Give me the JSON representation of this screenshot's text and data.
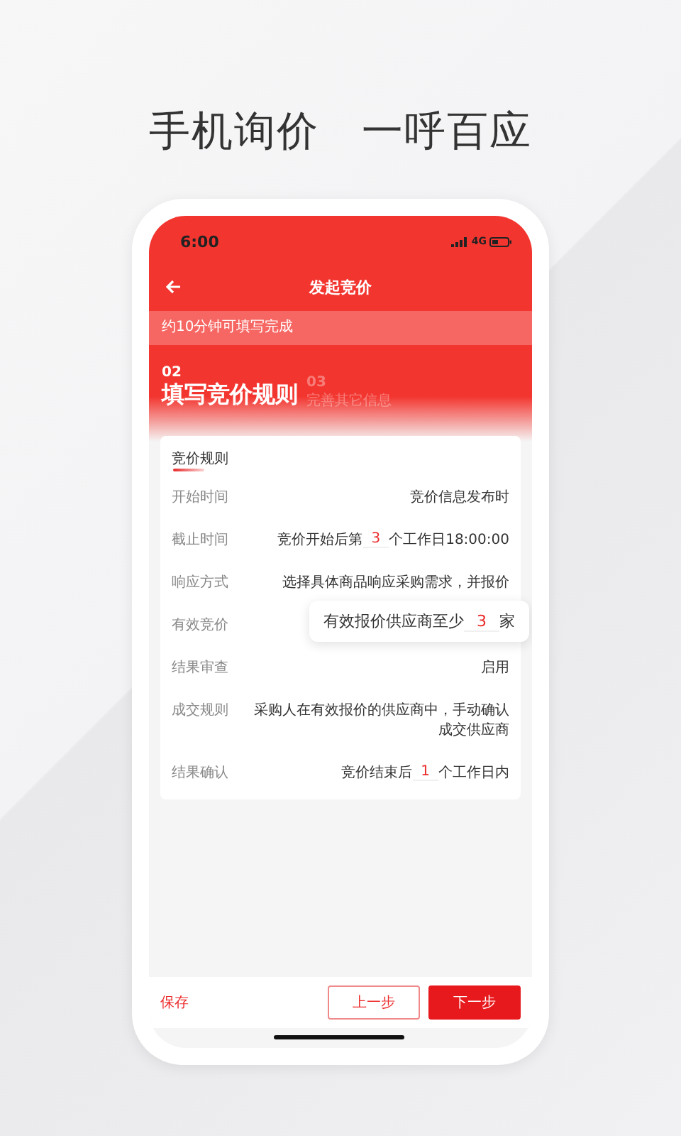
{
  "headline": [
    "手机询价",
    "一呼百应"
  ],
  "status_bar": {
    "time": "6:00",
    "network": "4G"
  },
  "nav": {
    "title": "发起竞价"
  },
  "notice": "约10分钟可填写完成",
  "steps": [
    {
      "number": "02",
      "label": "填写竞价规则",
      "selected": true
    },
    {
      "number": "03",
      "label": "完善其它信息",
      "selected": false
    }
  ],
  "card": {
    "title": "竞价规则",
    "rows": [
      {
        "label": "开始时间",
        "before": "竞价信息发布时"
      },
      {
        "label": "截止时间",
        "before": "竞价开始后第",
        "number": "3",
        "after": "个工作日18:00:00"
      },
      {
        "label": "响应方式",
        "before": "选择具体商品响应采购需求，并报价"
      },
      {
        "label": "有效竞价",
        "callout": {
          "before": "有效报价供应商至少",
          "number": "3",
          "after": "家"
        }
      },
      {
        "label": "结果审查",
        "before": "启用"
      },
      {
        "label": "成交规则",
        "before": "采购人在有效报价的供应商中，手动确认成交供应商"
      },
      {
        "label": "结果确认",
        "before": "竞价结束后",
        "number": "1",
        "after": "个工作日内"
      }
    ]
  },
  "footer": {
    "save": "保存",
    "prev": "上一步",
    "next": "下一步"
  }
}
